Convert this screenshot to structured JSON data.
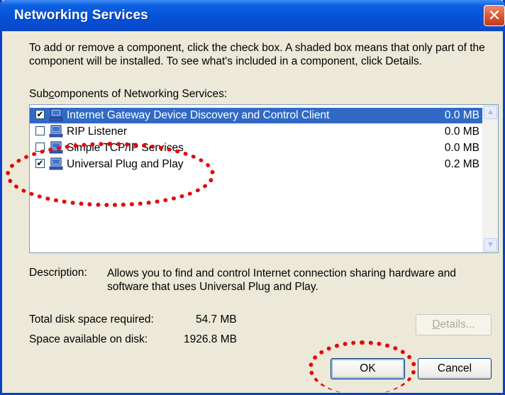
{
  "window": {
    "title": "Networking Services",
    "close_glyph": "✕"
  },
  "intro": "To add or remove a component, click the check box. A shaded box means that only part of the component will be installed. To see what's included in a component, click Details.",
  "subcomponents_label": {
    "pre": "Sub",
    "access": "c",
    "post": "omponents of Networking Services:"
  },
  "components": [
    {
      "label": "Internet Gateway Device Discovery and Control Client",
      "size": "0.0 MB",
      "checked": true,
      "selected": true,
      "icon": "network-computer-icon"
    },
    {
      "label": "RIP Listener",
      "size": "0.0 MB",
      "checked": false,
      "selected": false,
      "icon": "network-computer-icon"
    },
    {
      "label": "Simple TCP/IP Services",
      "size": "0.0 MB",
      "checked": false,
      "selected": false,
      "icon": "network-computer-icon"
    },
    {
      "label": "Universal Plug and Play",
      "size": "0.2 MB",
      "checked": true,
      "selected": false,
      "icon": "network-computer-icon"
    }
  ],
  "description": {
    "label": "Description:",
    "text": "Allows you to find and control Internet connection sharing hardware and software that uses Universal Plug and Play."
  },
  "disk": {
    "required_label": "Total disk space required:",
    "required_value": "54.7 MB",
    "available_label": "Space available on disk:",
    "available_value": "1926.8 MB"
  },
  "buttons": {
    "details": {
      "access": "D",
      "rest": "etails..."
    },
    "ok": "OK",
    "cancel": "Cancel"
  },
  "colors": {
    "highlight": "#e40a0a",
    "selection": "#316ac5",
    "titlebar": "#0552d8"
  }
}
